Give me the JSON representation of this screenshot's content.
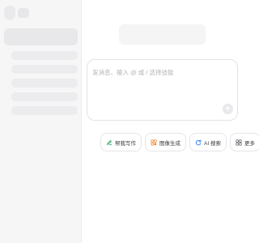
{
  "composer": {
    "placeholder": "发消息、输入 @ 或 / 选择技能"
  },
  "quick_actions": [
    {
      "label": "帮我写作",
      "icon": "pen-icon",
      "color": "#2fa86a"
    },
    {
      "label": "图像生成",
      "icon": "image-icon",
      "color": "#f08c2a"
    },
    {
      "label": "AI 搜索",
      "icon": "search-refresh-icon",
      "color": "#3b82f6"
    },
    {
      "label": "更多",
      "icon": "grid-icon",
      "color": "#6b6b73"
    }
  ]
}
